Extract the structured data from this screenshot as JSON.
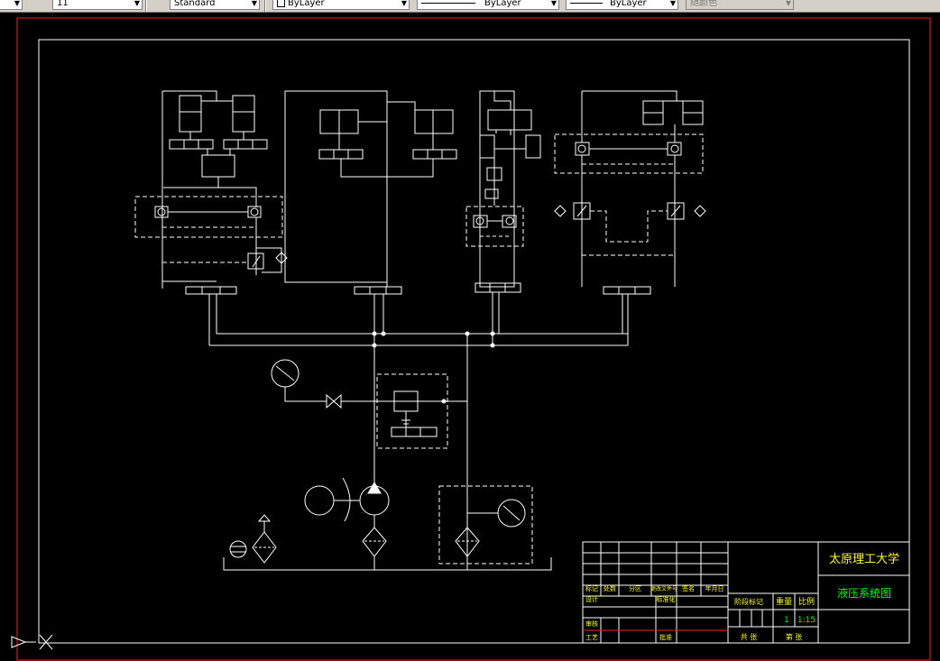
{
  "toolbar": {
    "layer_value": "11",
    "text_style": "Standard",
    "color_value": "ByLayer",
    "linetype_value": "ByLayer",
    "lineweight_value": "ByLayer",
    "plot_style": "随颜色"
  },
  "title_block": {
    "school": "太原理工大学",
    "drawing_title": "液压系统图",
    "scale_label": "比例",
    "scale_value": "1:15",
    "weight_label": "重量",
    "quantity_value": "1",
    "stage_mark_label": "阶段标记",
    "rev_headers": [
      "标记",
      "处数",
      "分区",
      "更改文件号",
      "签名",
      "年月日"
    ],
    "design_label": "设计",
    "std_label": "标准化",
    "audit_label": "审核",
    "process_label": "工艺",
    "approve_label": "批准",
    "sheets_label": "共 张",
    "sheet_label": "第 张"
  },
  "colors": {
    "background": "#000000",
    "lines": "#ffffff",
    "dashed": "#ffffff",
    "border_red": "#ff0000",
    "title_text": "#00ff00",
    "title_text_yellow": "#ffff00"
  }
}
